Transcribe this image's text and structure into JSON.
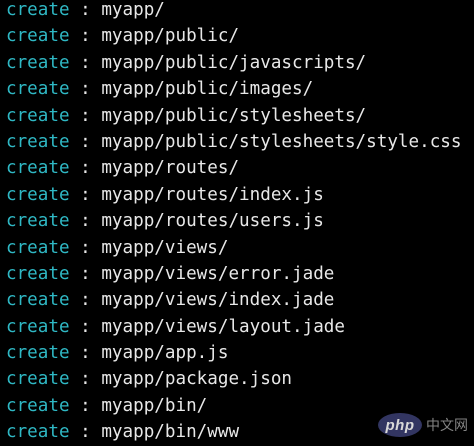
{
  "terminal": {
    "separator": " : ",
    "lines": [
      {
        "verb": "create",
        "path": "myapp/"
      },
      {
        "verb": "create",
        "path": "myapp/public/"
      },
      {
        "verb": "create",
        "path": "myapp/public/javascripts/"
      },
      {
        "verb": "create",
        "path": "myapp/public/images/"
      },
      {
        "verb": "create",
        "path": "myapp/public/stylesheets/"
      },
      {
        "verb": "create",
        "path": "myapp/public/stylesheets/style.css"
      },
      {
        "verb": "create",
        "path": "myapp/routes/"
      },
      {
        "verb": "create",
        "path": "myapp/routes/index.js"
      },
      {
        "verb": "create",
        "path": "myapp/routes/users.js"
      },
      {
        "verb": "create",
        "path": "myapp/views/"
      },
      {
        "verb": "create",
        "path": "myapp/views/error.jade"
      },
      {
        "verb": "create",
        "path": "myapp/views/index.jade"
      },
      {
        "verb": "create",
        "path": "myapp/views/layout.jade"
      },
      {
        "verb": "create",
        "path": "myapp/app.js"
      },
      {
        "verb": "create",
        "path": "myapp/package.json"
      },
      {
        "verb": "create",
        "path": "myapp/bin/"
      },
      {
        "verb": "create",
        "path": "myapp/bin/www"
      }
    ]
  },
  "watermark": {
    "logo_text": "php",
    "site_text": "中文网"
  },
  "colors": {
    "background": "#000000",
    "verb": "#2fb8c4",
    "text": "#e8e8e8",
    "logo_bg": "#3b3f72"
  }
}
